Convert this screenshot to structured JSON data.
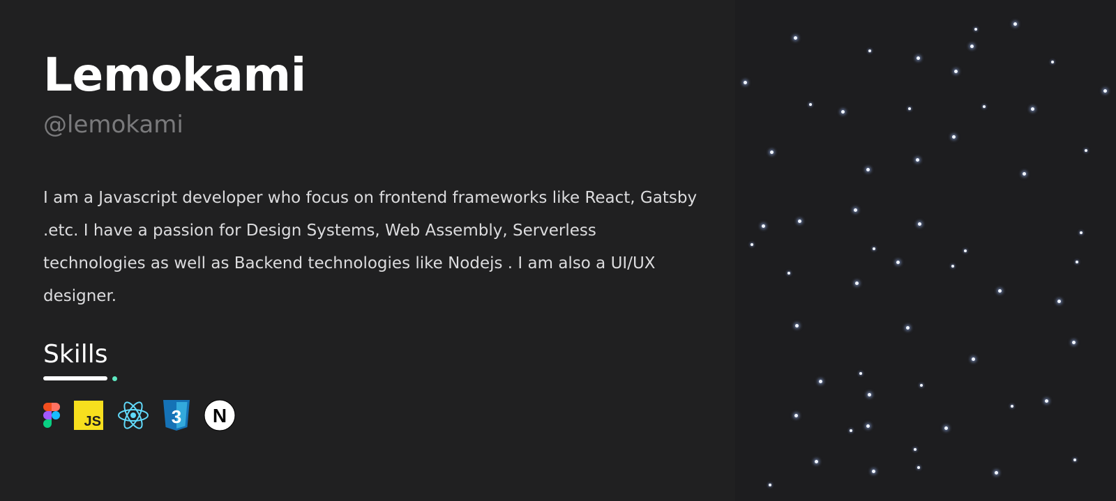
{
  "profile": {
    "name": "Lemokami",
    "handle": "@lemokami",
    "bio": "I am a Javascript developer who focus on frontend frameworks like React, Gatsby .etc. I have a passion for Design Systems, Web Assembly, Serverless technologies as well as Backend technologies like Nodejs . I am also a UI/UX designer."
  },
  "skills": {
    "heading": "Skills",
    "accent_color": "#5ee8c1",
    "items": [
      {
        "icon": "figma-icon"
      },
      {
        "icon": "javascript-icon",
        "label": "JS",
        "color": "#f7df1e"
      },
      {
        "icon": "react-icon",
        "color": "#61dafb"
      },
      {
        "icon": "css3-icon",
        "label": "3",
        "color": "#1572b6"
      },
      {
        "icon": "nextjs-icon",
        "label": "N"
      }
    ]
  },
  "theme": {
    "background": "#202021",
    "star_color": "#f2f6ff"
  }
}
